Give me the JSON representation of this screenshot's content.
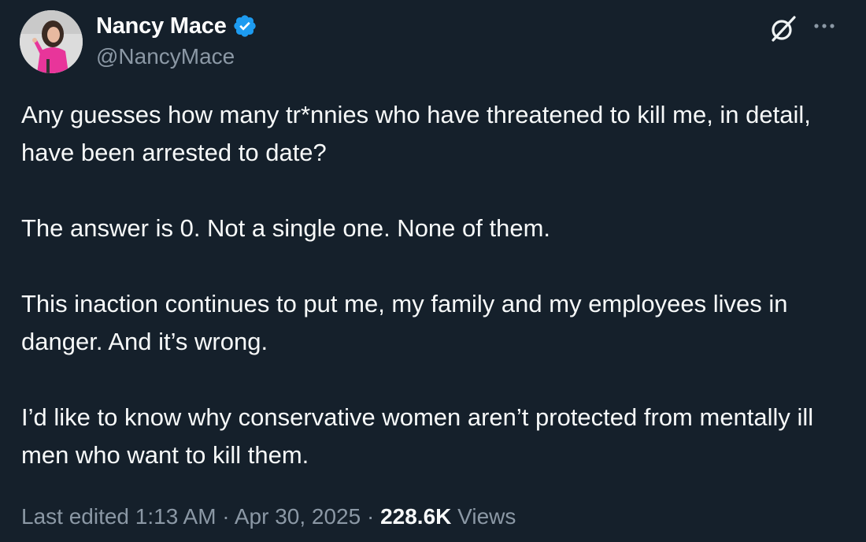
{
  "author": {
    "display_name": "Nancy Mace",
    "handle": "@NancyMace",
    "verified": true,
    "verified_color": "#1d9bf0",
    "avatar_icon": "profile-photo"
  },
  "header_icons": {
    "grok": "grok-icon",
    "more": "more-options-icon"
  },
  "tweet": {
    "paragraphs": [
      "Any guesses how many tr*nnies who have threatened to kill me, in detail, have been arrested to date?",
      "The answer is 0. Not a single one. None of them.",
      "This inaction continues to put me, my family and my employees lives in danger. And it’s wrong.",
      "I’d like to know why conservative women aren’t protected from mentally ill men who want to kill them."
    ]
  },
  "meta": {
    "edited_label": "Last edited",
    "time": "1:13 AM",
    "separator": "·",
    "date": "Apr 30, 2025",
    "views_count": "228.6K",
    "views_label": "Views"
  },
  "colors": {
    "background": "#15202b",
    "text_primary": "#f7f9f9",
    "text_secondary": "#8b98a5",
    "accent": "#1d9bf0"
  }
}
